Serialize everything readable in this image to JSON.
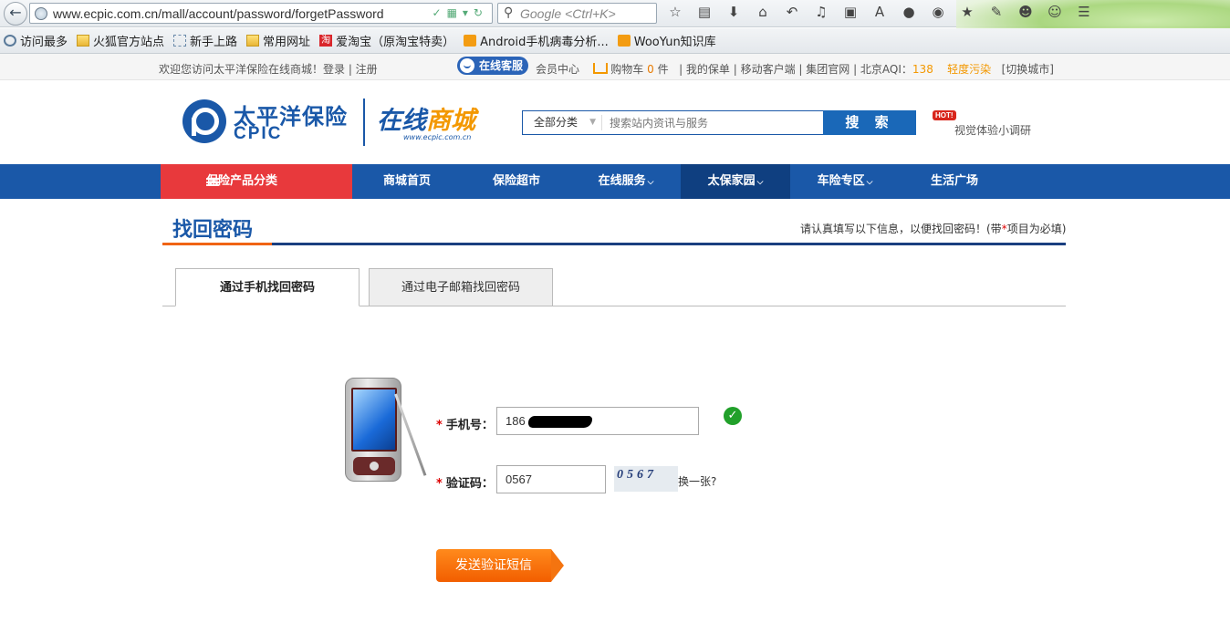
{
  "browser": {
    "url": "www.ecpic.com.cn/mall/account/password/forgetPassword",
    "search_placeholder": "Google <Ctrl+K>",
    "bookmarks": [
      "访问最多",
      "火狐官方站点",
      "新手上路",
      "常用网址",
      "爱淘宝（原淘宝特卖）",
      "Android手机病毒分析...",
      "WooYun知识库"
    ],
    "toolbar_icons": [
      "star-icon",
      "reader-icon",
      "download-icon",
      "home-icon",
      "undo-icon",
      "menu-arrow-icon",
      "volume-icon",
      "crop-icon",
      "menu-arrow-icon",
      "dictionary-icon",
      "chat-icon",
      "weibo-icon",
      "menu-arrow-icon",
      "extension-icon",
      "paint-icon",
      "menu-arrow-icon",
      "monkey-icon",
      "smile-icon",
      "hamburger-menu-icon"
    ]
  },
  "topbar": {
    "welcome": "欢迎您访问太平洋保险在线商城！登录 | 注册",
    "kefu": "在线客服",
    "member": "会员中心",
    "cart_label": "购物车",
    "cart_count": "0",
    "cart_unit": "件",
    "links": "|  我的保单  | 移动客户端 |  集团官网   |  北京AQI：",
    "aqi": "138",
    "aqi_level": "轻度污染",
    "switch_city": "[切换城市]"
  },
  "header": {
    "logo_cn": "太平洋保险",
    "logo_en": "CPIC",
    "mall_logo_a": "在线",
    "mall_logo_b": "商城",
    "mall_url": "www.ecpic.com.cn",
    "category": "全部分类",
    "search_placeholder": "搜索站内资讯与服务",
    "search_button": "搜 索",
    "hot": "HOT!",
    "survey": "视觉体验小调研"
  },
  "nav": {
    "category": "保险产品分类",
    "items": [
      "商城首页",
      "保险超市",
      "在线服务",
      "太保家园",
      "车险专区",
      "生活广场"
    ]
  },
  "page": {
    "title": "找回密码",
    "hint_before": "请认真填写以下信息，以便找回密码！(带",
    "hint_star": "*",
    "hint_after": "项目为必填)",
    "tab_phone": "通过手机找回密码",
    "tab_email": "通过电子邮箱找回密码"
  },
  "form": {
    "phone_label": "手机号：",
    "phone_value": "186",
    "captcha_label": "验证码：",
    "captcha_value": "0567",
    "captcha_image_text": "0567",
    "refresh": "换一张?",
    "send_button": "发送验证短信",
    "required_mark": "*"
  }
}
